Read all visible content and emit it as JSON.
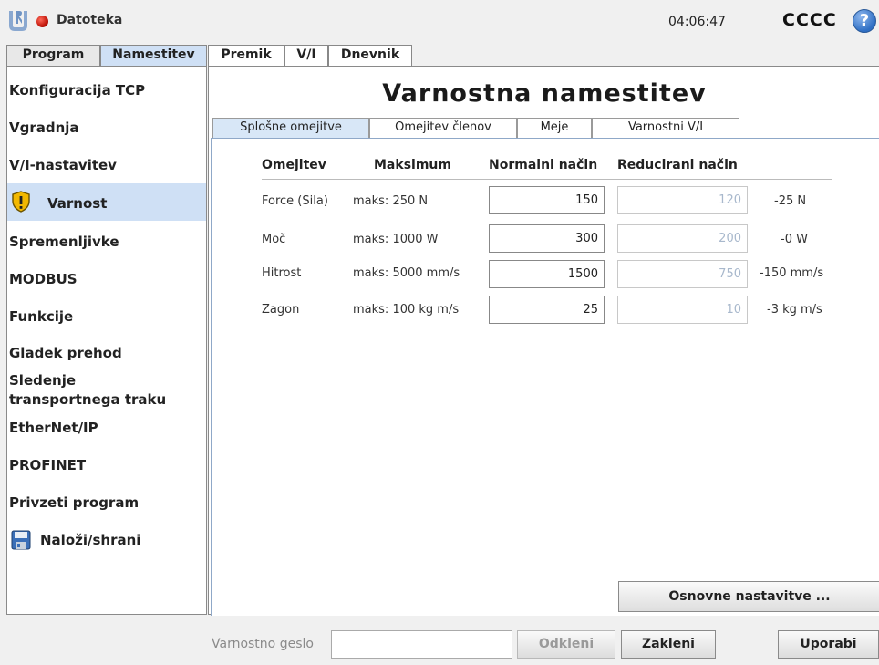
{
  "header": {
    "file_menu": "Datoteka",
    "time": "04:06:47",
    "robot_name": "CCCC",
    "help_glyph": "?"
  },
  "main_tabs": [
    {
      "label": "Program"
    },
    {
      "label": "Namestitev",
      "active": true
    }
  ],
  "sub_tabs": [
    {
      "label": "Premik"
    },
    {
      "label": "V/I"
    },
    {
      "label": "Dnevnik"
    }
  ],
  "sidebar": {
    "items": [
      {
        "label": "Konfiguracija TCP"
      },
      {
        "label": "Vgradnja"
      },
      {
        "label": "V/I-nastavitev"
      },
      {
        "label": "Varnost",
        "active": true,
        "icon": "warning-shield-icon"
      },
      {
        "label": "Spremenljivke"
      },
      {
        "label": "MODBUS"
      },
      {
        "label": "Funkcije"
      },
      {
        "label": "Gladek prehod"
      },
      {
        "label": "Sledenje transportnega traku"
      },
      {
        "label": "EtherNet/IP"
      },
      {
        "label": "PROFINET"
      },
      {
        "label": "Privzeti program"
      },
      {
        "label": "Naloži/shrani",
        "icon": "floppy-disk-icon"
      }
    ]
  },
  "page": {
    "title": "Varnostna namestitev",
    "tabs": [
      {
        "label": "Splošne omejitve",
        "active": true
      },
      {
        "label": "Omejitev členov"
      },
      {
        "label": "Meje"
      },
      {
        "label": "Varnostni V/I"
      }
    ]
  },
  "limits_table": {
    "headers": [
      "Omejitev",
      "Maksimum",
      "Normalni način",
      "Reducirani način"
    ],
    "rows": [
      {
        "name": "Force (Sila)",
        "max": "maks: 250 N",
        "normal": "150",
        "reduced": "120",
        "diff": "-25 N"
      },
      {
        "name": "Moč",
        "max": "maks: 1000 W",
        "normal": "300",
        "reduced": "200",
        "diff": "-0 W"
      },
      {
        "name": "Hitrost",
        "max": "maks: 5000 mm/s",
        "normal": "1500",
        "reduced": "750",
        "diff": "-150 mm/s"
      },
      {
        "name": "Zagon",
        "max": "maks: 100 kg m/s",
        "normal": "25",
        "reduced": "10",
        "diff": "-3 kg m/s"
      }
    ]
  },
  "basic_settings_button": "Osnovne nastavitve ...",
  "footer": {
    "password_label": "Varnostno geslo",
    "password_value": "",
    "unlock": "Odkleni",
    "lock": "Zakleni",
    "apply": "Uporabi"
  },
  "colors": {
    "active_tab": "#cfe0f5",
    "error_dot": "#d0170a",
    "help": "#2f6fc4",
    "warning": "#f2b800"
  }
}
